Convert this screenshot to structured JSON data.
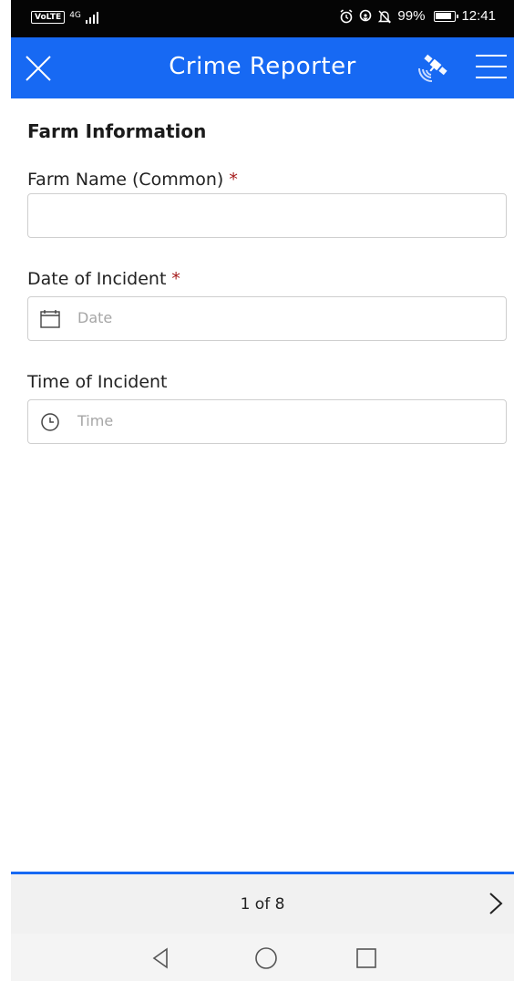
{
  "status_bar": {
    "volte": "VoLTE",
    "network": "4G",
    "battery": "99%",
    "time": "12:41",
    "icons": [
      "alarm-icon",
      "location-icon",
      "mute-icon",
      "battery-icon"
    ]
  },
  "header": {
    "title": "Crime Reporter",
    "background": "#1769f3",
    "icons": [
      "close-icon",
      "gps-icon",
      "menu-icon"
    ]
  },
  "form": {
    "section_title": "Farm Information",
    "fields": [
      {
        "label": "Farm Name (Common)",
        "required": "*",
        "value": "",
        "placeholder": ""
      },
      {
        "label": "Date of Incident",
        "required": "*",
        "placeholder": "Date",
        "icon": "calendar-icon"
      },
      {
        "label": "Time of Incident",
        "placeholder": "Time",
        "icon": "clock-icon"
      }
    ],
    "required_color": "#a51a1a"
  },
  "pager": {
    "text": "1 of 8",
    "icon": "chevron-right-icon"
  },
  "nav_bar": {
    "icons": [
      "back-icon",
      "home-icon",
      "recents-icon"
    ]
  }
}
